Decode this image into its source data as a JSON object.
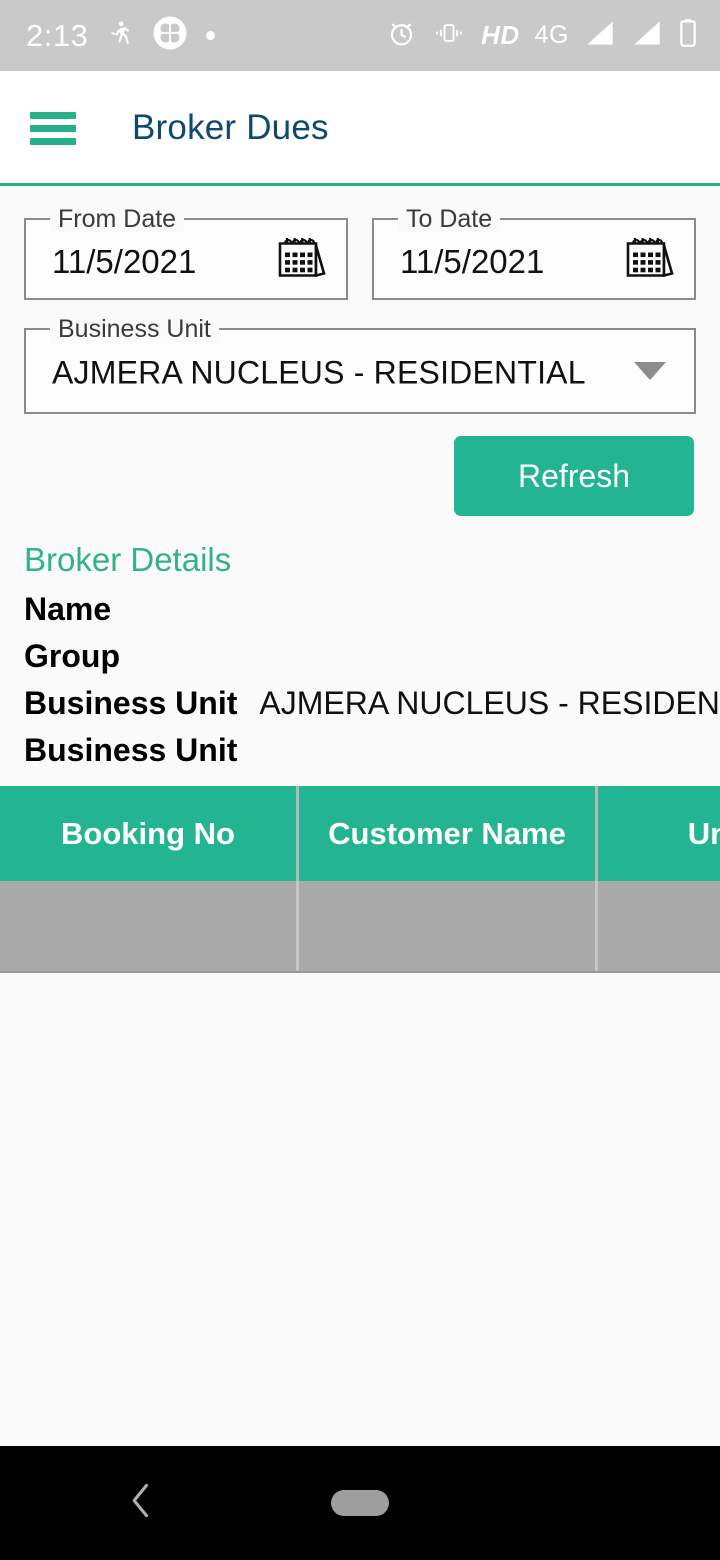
{
  "status_bar": {
    "time": "2:13",
    "network_type": "4G",
    "hd_label": "HD",
    "left_icons": [
      "directions-walk-icon",
      "clover-app-icon",
      "dot-indicator-icon"
    ],
    "right_icons": [
      "alarm-icon",
      "vibrate-icon",
      "hd-icon",
      "network-4g-icon",
      "signal-bar-icon",
      "signal-bar-icon",
      "battery-icon"
    ],
    "background_color": "#c9c9c9",
    "icon_color": "#ffffff"
  },
  "app_bar": {
    "menu_label": "menu",
    "title": "Broker Dues",
    "title_color": "#0d4a6e",
    "accent_color": "#26b08a"
  },
  "filters": {
    "from_date": {
      "label": "From Date",
      "value": "11/5/2021",
      "icon": "calendar-icon"
    },
    "to_date": {
      "label": "To Date",
      "value": "11/5/2021",
      "icon": "calendar-icon"
    },
    "business_unit": {
      "label": "Business Unit",
      "value": "AJMERA NUCLEUS - RESIDENTIAL",
      "icon": "chevron-down-icon"
    },
    "refresh_button": {
      "label": "Refresh",
      "color": "#23b491"
    }
  },
  "broker_details": {
    "title": "Broker Details",
    "title_color": "#32b289",
    "rows": [
      {
        "label": "Name",
        "value": ""
      },
      {
        "label": "Group",
        "value": ""
      },
      {
        "label": "Business Unit",
        "value": "AJMERA NUCLEUS - RESIDENTIAL"
      },
      {
        "label": "Business Unit",
        "value": ""
      }
    ]
  },
  "table": {
    "header_color": "#23b491",
    "row_color": "#aaaaaa",
    "columns": [
      "Booking No",
      "Customer Name",
      "Unit"
    ],
    "rows": [
      {
        "booking_no": "",
        "customer_name": "",
        "unit": ""
      }
    ]
  },
  "nav_bar": {
    "back_label": "back",
    "home_label": "home",
    "background_color": "#000000"
  }
}
